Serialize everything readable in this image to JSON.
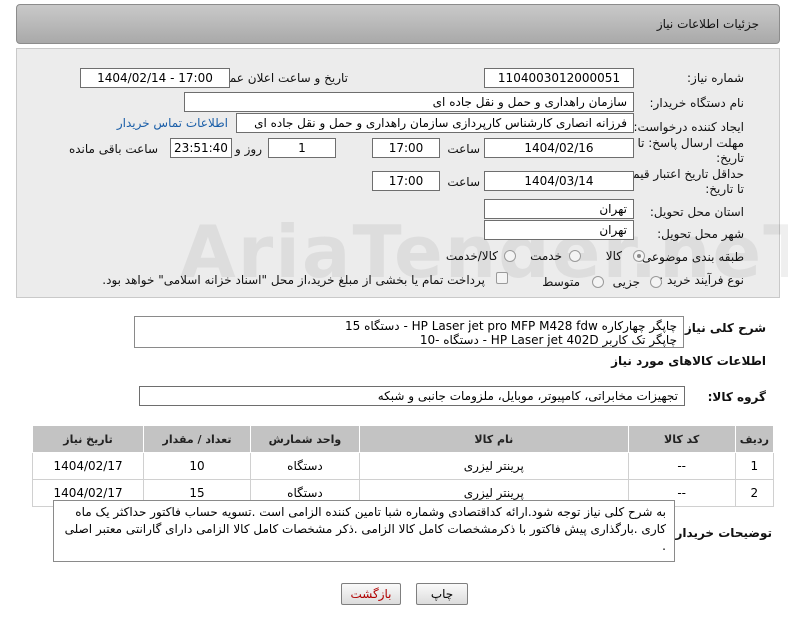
{
  "header": {
    "title": "جزئیات اطلاعات نیاز"
  },
  "fields": {
    "need_number_label": "شماره نیاز:",
    "need_number": "1104003012000051",
    "announce_label": "تاریخ و ساعت اعلان عمومی:",
    "announce_value": "1404/02/14 - 17:00",
    "buyer_org_label": "نام دستگاه خریدار:",
    "buyer_org": "سازمان راهداری و حمل و نقل جاده ای",
    "creator_label": "ایجاد کننده درخواست:",
    "creator": "فرزانه انصاری کارشناس کارپردازی سازمان راهداری و حمل و نقل جاده ای",
    "contact_link": "اطلاعات تماس خریدار",
    "deadline_label_1": "مهلت ارسال پاسخ: تا",
    "deadline_label_2": "تاریخ:",
    "deadline_date": "1404/02/16",
    "time_label": "ساعت",
    "deadline_time": "17:00",
    "days_value": "1",
    "days_label": "روز و",
    "remaining_time": "23:51:40",
    "remaining_label": "ساعت باقی مانده",
    "validity_label_1": "حداقل تاریخ اعتبار قیمت:",
    "validity_label_2": "تا تاریخ:",
    "validity_date": "1404/03/14",
    "validity_time": "17:00",
    "province_label": "استان محل تحویل:",
    "province": "تهران",
    "city_label": "شهر محل تحویل:",
    "city": "تهران",
    "category_label": "طبقه بندی موضوعی:",
    "category_options": [
      "کالا",
      "خدمت",
      "کالا/خدمت"
    ],
    "category_selected": "کالا",
    "process_label": "نوع فرآیند خرید :",
    "process_options": [
      "جزیی",
      "متوسط"
    ],
    "payment_note": "پرداخت تمام یا بخشی از مبلغ خرید،از محل \"اسناد خزانه اسلامی\" خواهد بود."
  },
  "description": {
    "label": "شرح کلی نیاز:",
    "line1": "چاپگر چهارکاره     HP Laser jet pro MFP M428 fdw  - دستگاه  15",
    "line2": "چاپگر تک کاربر     HP Laser jet 402D     -      دستگاه -10"
  },
  "goods_section": {
    "title": "اطلاعات کالاهای مورد نیاز",
    "group_label": "گروه کالا:",
    "group_value": "تجهیزات مخابراتی، کامپیوتر، موبایل، ملزومات جانبی و شبکه"
  },
  "table": {
    "headers": [
      "ردیف",
      "کد کالا",
      "نام کالا",
      "واحد شمارش",
      "تعداد / مقدار",
      "تاریخ نیاز"
    ],
    "rows": [
      [
        "1",
        "--",
        "پرینتر لیزری",
        "دستگاه",
        "10",
        "1404/02/17"
      ],
      [
        "2",
        "--",
        "پرینتر لیزری",
        "دستگاه",
        "15",
        "1404/02/17"
      ]
    ]
  },
  "buyer_notes": {
    "label": "توضیحات خریدار:",
    "text": "به شرح کلی نیاز توجه شود.ارائه کداقتصادی وشماره شبا تامین کننده الزامی است .تسویه حساب فاکتور حداکثر یک ماه کاری .بارگذاری پیش فاکتور با ذکرمشخصات کامل کالا الزامی .ذکر مشخصات کامل کالا الزامی دارای گارانتی معتبر اصلی ."
  },
  "buttons": {
    "print": "چاپ",
    "back": "بازگشت"
  },
  "watermark": "AriaTender.neT",
  "colors": {
    "link": "#1a5ea8",
    "header_bg": "#b5b5b5",
    "back_button_text": "#b00000"
  }
}
